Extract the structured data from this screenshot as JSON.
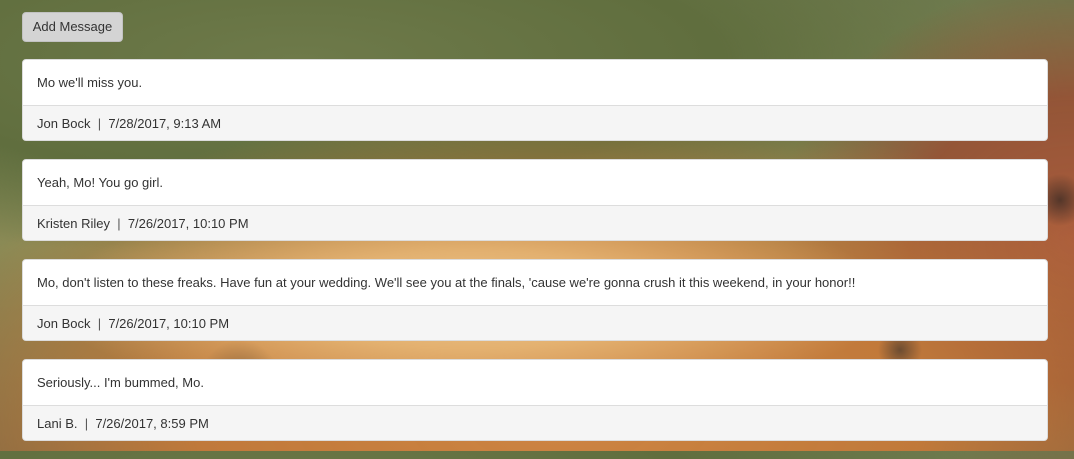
{
  "toolbar": {
    "add_message_label": "Add Message"
  },
  "messages": [
    {
      "text": "Mo we'll miss you.",
      "author": "Jon Bock",
      "separator": "|",
      "timestamp": "7/28/2017, 9:13 AM"
    },
    {
      "text": "Yeah, Mo! You go girl.",
      "author": "Kristen Riley",
      "separator": "|",
      "timestamp": "7/26/2017, 10:10 PM"
    },
    {
      "text": "Mo, don't listen to these freaks. Have fun at your wedding. We'll see you at the finals, 'cause we're gonna crush it this weekend, in your honor!!",
      "author": "Jon Bock",
      "separator": "|",
      "timestamp": "7/26/2017, 10:10 PM"
    },
    {
      "text": "Seriously... I'm bummed, Mo.",
      "author": "Lani B.",
      "separator": "|",
      "timestamp": "7/26/2017, 8:59 PM"
    }
  ]
}
